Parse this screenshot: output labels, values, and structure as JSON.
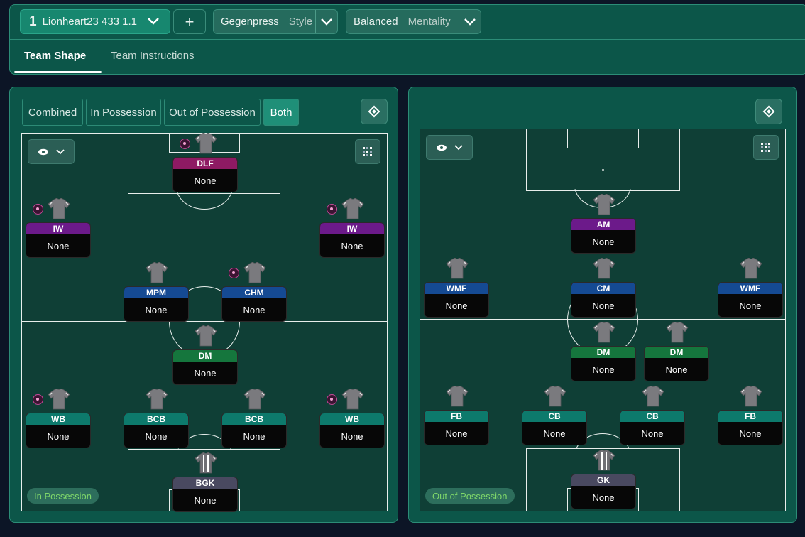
{
  "topbar": {
    "tactic_number": "1",
    "tactic_name": "Lionheart23 433 1.1",
    "add_label": "+",
    "style_value": "Gegenpress",
    "style_label": "Style",
    "mentality_value": "Balanced",
    "mentality_label": "Mentality",
    "tabs": [
      "Team Shape",
      "Team Instructions"
    ]
  },
  "left_panel": {
    "segments": [
      "Combined",
      "In Possession",
      "Out of Possession",
      "Both"
    ],
    "active_segment": "Both",
    "phase_label": "In Possession",
    "players": [
      {
        "role": "DLF",
        "name": "None",
        "color": "#8e1a63",
        "instruction_dot": true
      },
      {
        "role": "IW",
        "name": "None",
        "color": "#6c1a8a",
        "instruction_dot": true
      },
      {
        "role": "IW",
        "name": "None",
        "color": "#6c1a8a",
        "instruction_dot": true
      },
      {
        "role": "MPM",
        "name": "None",
        "color": "#154a93",
        "instruction_dot": false
      },
      {
        "role": "CHM",
        "name": "None",
        "color": "#154a93",
        "instruction_dot": true
      },
      {
        "role": "DM",
        "name": "None",
        "color": "#15763d",
        "instruction_dot": false
      },
      {
        "role": "WB",
        "name": "None",
        "color": "#0d7a6c",
        "instruction_dot": true
      },
      {
        "role": "BCB",
        "name": "None",
        "color": "#0d7a6c",
        "instruction_dot": false
      },
      {
        "role": "BCB",
        "name": "None",
        "color": "#0d7a6c",
        "instruction_dot": false
      },
      {
        "role": "WB",
        "name": "None",
        "color": "#0d7a6c",
        "instruction_dot": true
      },
      {
        "role": "BGK",
        "name": "None",
        "color": "#494960",
        "instruction_dot": false
      }
    ]
  },
  "right_panel": {
    "phase_label": "Out of Possession",
    "players": [
      {
        "role": "AM",
        "name": "None",
        "color": "#6c1a8a"
      },
      {
        "role": "WMF",
        "name": "None",
        "color": "#154a93"
      },
      {
        "role": "CM",
        "name": "None",
        "color": "#154a93"
      },
      {
        "role": "WMF",
        "name": "None",
        "color": "#154a93"
      },
      {
        "role": "DM",
        "name": "None",
        "color": "#15763d"
      },
      {
        "role": "DM",
        "name": "None",
        "color": "#15763d"
      },
      {
        "role": "FB",
        "name": "None",
        "color": "#0d7a6c"
      },
      {
        "role": "CB",
        "name": "None",
        "color": "#0d7a6c"
      },
      {
        "role": "CB",
        "name": "None",
        "color": "#0d7a6c"
      },
      {
        "role": "FB",
        "name": "None",
        "color": "#0d7a6c"
      },
      {
        "role": "GK",
        "name": "None",
        "color": "#494960"
      }
    ]
  },
  "colors": {
    "background": "#0c1526",
    "panel": "#0c5649",
    "pitch": "#0f3f36",
    "accent": "#1f8f78",
    "phase_text": "#7fd76a"
  }
}
